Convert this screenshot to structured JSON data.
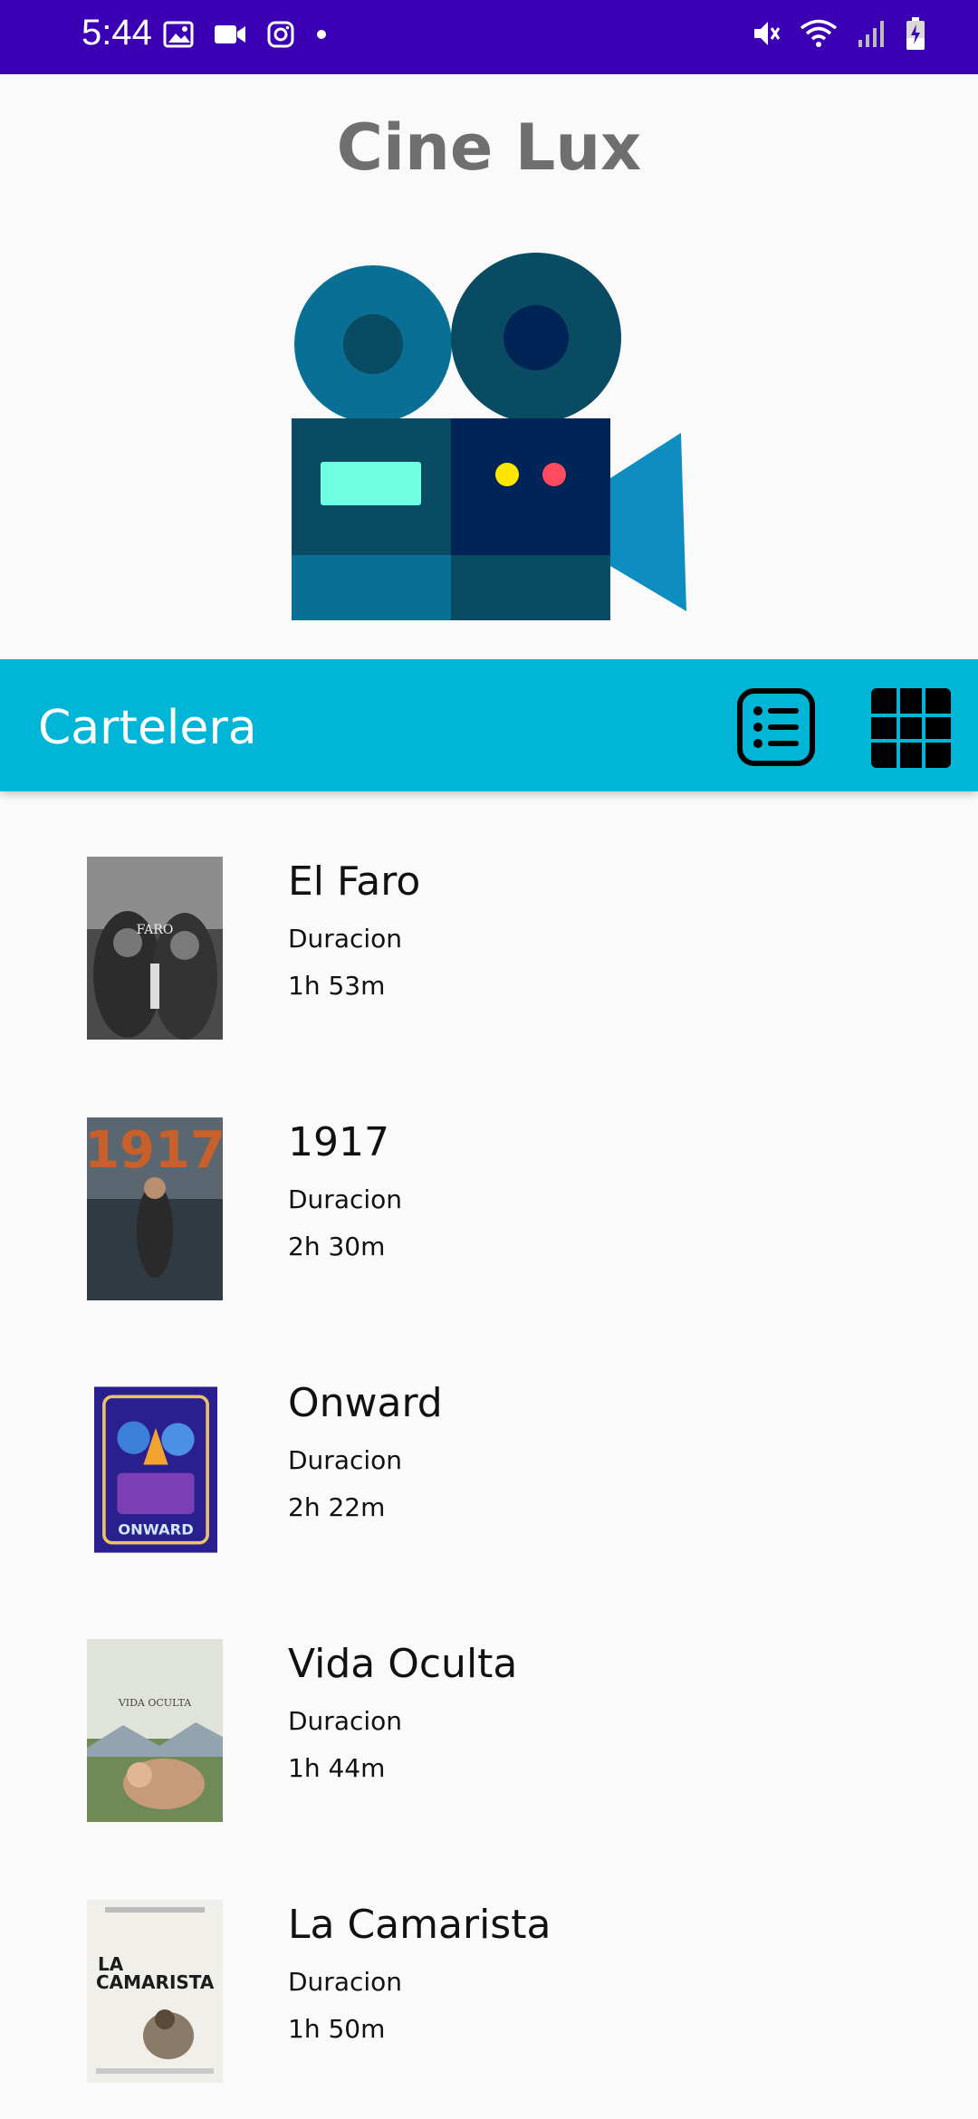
{
  "status_bar": {
    "time": "5:44",
    "icons_left": [
      "image-icon",
      "video-icon",
      "instagram-icon",
      "dot-icon"
    ],
    "icons_right": [
      "mute-icon",
      "wifi-icon",
      "signal-icon",
      "battery-icon"
    ]
  },
  "app": {
    "title": "Cine Lux"
  },
  "toolbar": {
    "title": "Cartelera",
    "list_view_icon": "list-view-icon",
    "grid_view_icon": "grid-view-icon"
  },
  "movies": [
    {
      "title": "El Faro",
      "label": "Duracion",
      "duration": "1h 53m"
    },
    {
      "title": "1917",
      "label": "Duracion",
      "duration": "2h 30m"
    },
    {
      "title": "Onward",
      "label": "Duracion",
      "duration": "2h 22m"
    },
    {
      "title": "Vida Oculta",
      "label": "Duracion",
      "duration": "1h 44m"
    },
    {
      "title": "La Camarista",
      "label": "Duracion",
      "duration": "1h 50m"
    }
  ],
  "posters": {
    "0": {
      "text1": "FARO"
    },
    "1": {
      "text1": "1917"
    },
    "2": {
      "text1": "ONWARD"
    },
    "3": {
      "text1": "VIDA OCULTA"
    },
    "4": {
      "text1": "LA",
      "text2": "CAMARISTA"
    }
  },
  "colors": {
    "status_bar": "#3b00b3",
    "toolbar": "#00b5d6",
    "title_gray": "#6f6f6f"
  }
}
